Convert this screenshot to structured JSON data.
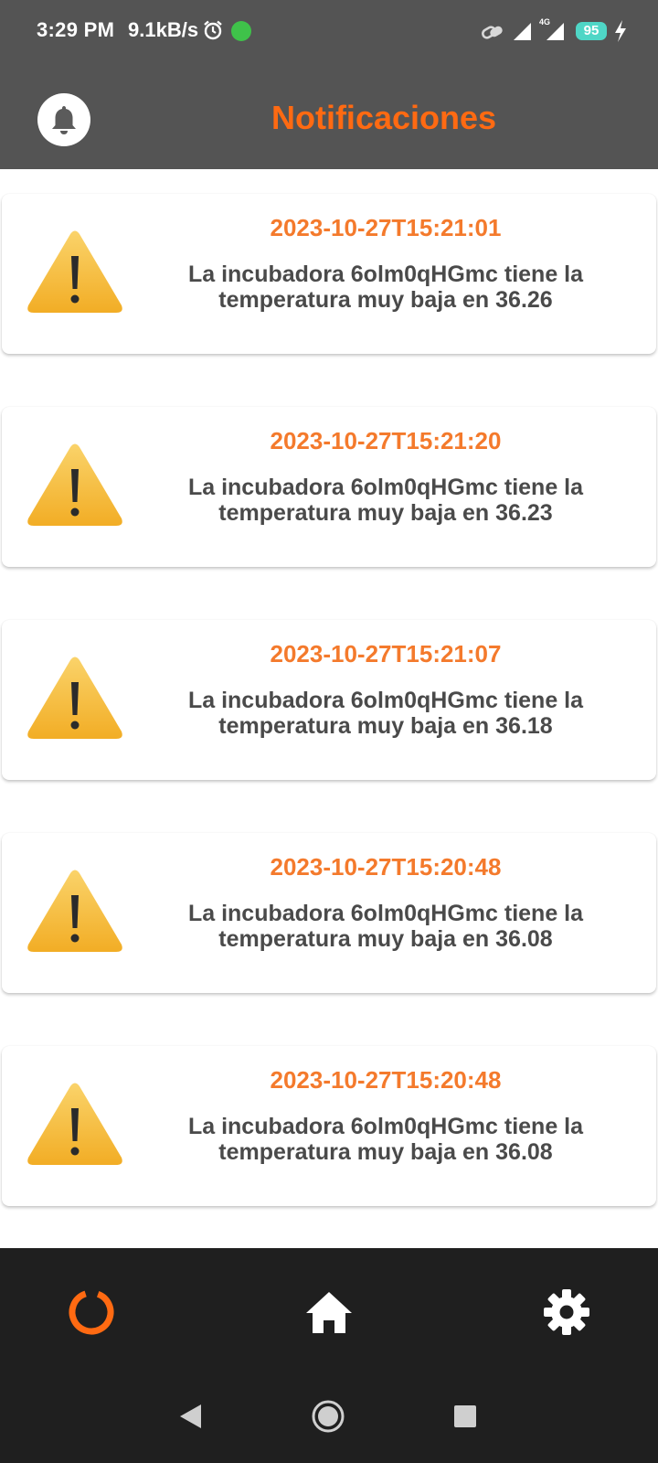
{
  "status_bar": {
    "time": "3:29 PM",
    "speed": "9.1kB/s",
    "network": "4G",
    "battery": "95"
  },
  "header": {
    "title": "Notificaciones",
    "bell_icon": "bell-icon"
  },
  "notifications": [
    {
      "date": "2023-10-27T15:21:01",
      "message": "La incubadora 6olm0qHGmc tiene la temperatura muy baja en 36.26",
      "icon": "warning-icon"
    },
    {
      "date": "2023-10-27T15:21:20",
      "message": "La incubadora 6olm0qHGmc tiene la temperatura muy baja en 36.23",
      "icon": "warning-icon"
    },
    {
      "date": "2023-10-27T15:21:07",
      "message": "La incubadora 6olm0qHGmc tiene la temperatura muy baja en 36.18",
      "icon": "warning-icon"
    },
    {
      "date": "2023-10-27T15:20:48",
      "message": "La incubadora 6olm0qHGmc tiene la temperatura muy baja en 36.08",
      "icon": "warning-icon"
    },
    {
      "date": "2023-10-27T15:20:48",
      "message": "La incubadora 6olm0qHGmc tiene la temperatura muy baja en 36.08",
      "icon": "warning-icon"
    }
  ],
  "bottom_nav": {
    "items": [
      {
        "icon": "dashboard-ring-icon",
        "active": true
      },
      {
        "icon": "home-icon",
        "active": false
      },
      {
        "icon": "gear-icon",
        "active": false
      }
    ]
  },
  "colors": {
    "header_bg": "#545454",
    "accent": "#ff6a12",
    "date_text": "#f47a2c",
    "message_text": "#4a4a4a",
    "nav_bg": "#1f1f1f",
    "warning_yellow": "#f6be3a"
  }
}
